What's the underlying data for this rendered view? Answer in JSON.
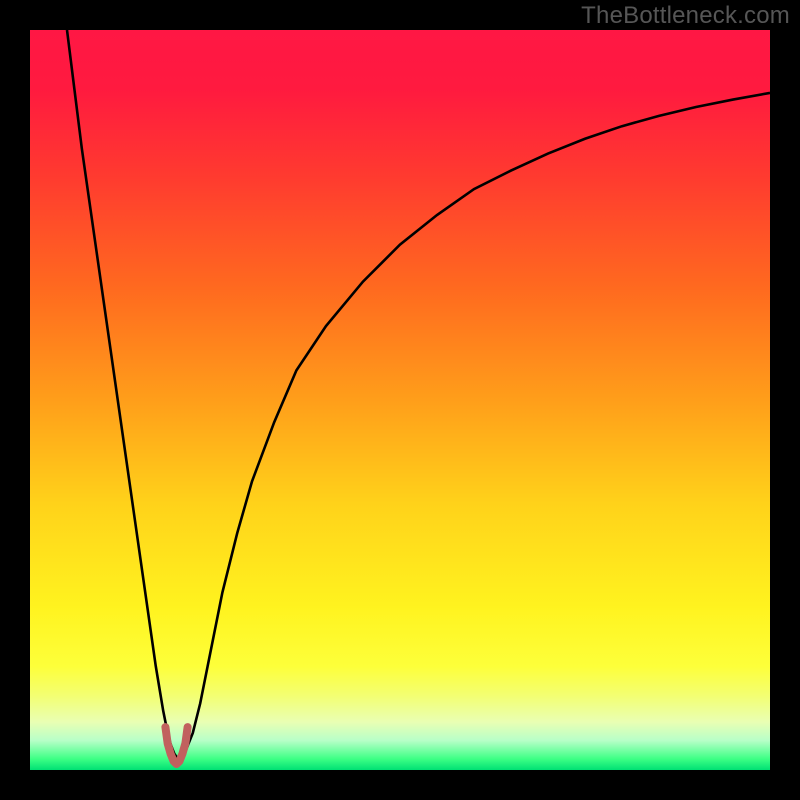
{
  "attribution": "TheBottleneck.com",
  "chart_data": {
    "type": "line",
    "title": "",
    "xlabel": "",
    "ylabel": "",
    "xlim": [
      0,
      100
    ],
    "ylim": [
      0,
      100
    ],
    "gradient_stops": [
      {
        "offset": 0.0,
        "color": "#ff1744"
      },
      {
        "offset": 0.08,
        "color": "#ff1a3f"
      },
      {
        "offset": 0.2,
        "color": "#ff3b2f"
      },
      {
        "offset": 0.35,
        "color": "#ff6a1f"
      },
      {
        "offset": 0.5,
        "color": "#ff9e1a"
      },
      {
        "offset": 0.64,
        "color": "#ffd21a"
      },
      {
        "offset": 0.78,
        "color": "#fff31f"
      },
      {
        "offset": 0.86,
        "color": "#fdff3a"
      },
      {
        "offset": 0.9,
        "color": "#f3ff73"
      },
      {
        "offset": 0.935,
        "color": "#e9ffb3"
      },
      {
        "offset": 0.96,
        "color": "#b8ffc8"
      },
      {
        "offset": 0.985,
        "color": "#3dff85"
      },
      {
        "offset": 1.0,
        "color": "#00e074"
      }
    ],
    "series": [
      {
        "name": "bottleneck-curve",
        "color": "#000000",
        "width": 2.6,
        "x": [
          5,
          6,
          7,
          8,
          9,
          10,
          11,
          12,
          13,
          14,
          15,
          16,
          17,
          17.5,
          18,
          18.5,
          19,
          19.5,
          20,
          20.5,
          21,
          22,
          23,
          24,
          26,
          28,
          30,
          33,
          36,
          40,
          45,
          50,
          55,
          60,
          65,
          70,
          75,
          80,
          85,
          90,
          95,
          100
        ],
        "values": [
          100,
          92,
          84,
          77,
          70,
          63,
          56,
          49,
          42,
          35,
          28,
          21,
          14,
          11,
          8,
          5.5,
          3.5,
          2.2,
          1.5,
          1.5,
          2.5,
          5,
          9,
          14,
          24,
          32,
          39,
          47,
          54,
          60,
          66,
          71,
          75,
          78.5,
          81,
          83.3,
          85.3,
          87,
          88.4,
          89.6,
          90.6,
          91.5
        ]
      }
    ],
    "minimum_marker": {
      "color": "#c1615e",
      "width": 8,
      "x": [
        18.3,
        18.6,
        19.0,
        19.4,
        19.8,
        20.2,
        20.6,
        21.0,
        21.3
      ],
      "values": [
        5.8,
        3.6,
        2.2,
        1.2,
        0.8,
        1.2,
        2.2,
        3.6,
        5.8
      ]
    }
  }
}
